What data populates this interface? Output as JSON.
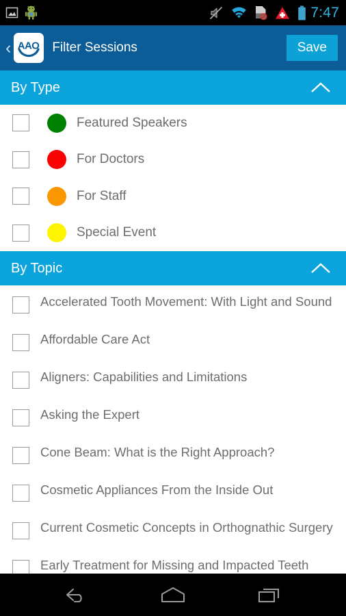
{
  "statusbar": {
    "time": "7:47",
    "icons_left": [
      "image-icon",
      "android-mascot-icon"
    ],
    "icons_right": [
      "mute-icon",
      "wifi-icon",
      "sd-card-disabled-icon",
      "alert-triangle-icon",
      "battery-icon"
    ],
    "colors": {
      "background": "#000000",
      "clock": "#33b5e5"
    }
  },
  "actionbar": {
    "back_label": "‹",
    "logo_text": "AAO",
    "title": "Filter Sessions",
    "save_label": "Save",
    "colors": {
      "background": "#0c5c97",
      "save_background": "#0ca2d8",
      "text": "#ffffff"
    }
  },
  "sections": [
    {
      "id": "by-type",
      "title": "By Type",
      "expanded": true,
      "chevron": "chevron-up-icon",
      "items": [
        {
          "label": "Featured Speakers",
          "color": "#008000",
          "checked": false
        },
        {
          "label": "For Doctors",
          "color": "#fa0000",
          "checked": false
        },
        {
          "label": "For Staff",
          "color": "#fa9600",
          "checked": false
        },
        {
          "label": "Special Event",
          "color": "#fdf500",
          "checked": false
        }
      ]
    },
    {
      "id": "by-topic",
      "title": "By Topic",
      "expanded": true,
      "chevron": "chevron-up-icon",
      "items": [
        {
          "label": "Accelerated Tooth Movement:  With Light and Sound",
          "checked": false
        },
        {
          "label": "Affordable Care Act",
          "checked": false
        },
        {
          "label": "Aligners: Capabilities and Limitations",
          "checked": false
        },
        {
          "label": "Asking the Expert",
          "checked": false
        },
        {
          "label": "Cone Beam:  What is the Right Approach?",
          "checked": false
        },
        {
          "label": "Cosmetic Appliances From the Inside Out",
          "checked": false
        },
        {
          "label": "Current Cosmetic Concepts in Orthognathic Surgery",
          "checked": false
        },
        {
          "label": "Early Treatment for Missing and Impacted Teeth",
          "checked": false
        }
      ]
    }
  ],
  "navbar": {
    "buttons": [
      {
        "name": "back-nav-button",
        "icon": "back-arrow-icon"
      },
      {
        "name": "home-nav-button",
        "icon": "home-icon"
      },
      {
        "name": "recents-nav-button",
        "icon": "recent-apps-icon"
      }
    ],
    "colors": {
      "background": "#000000",
      "icon": "#9a9a9a"
    }
  },
  "theme": {
    "section_header": "#0ba3db",
    "label_text": "#6d6d6d",
    "checkbox_border": "#9a9a9a",
    "page_background": "#ffffff"
  }
}
